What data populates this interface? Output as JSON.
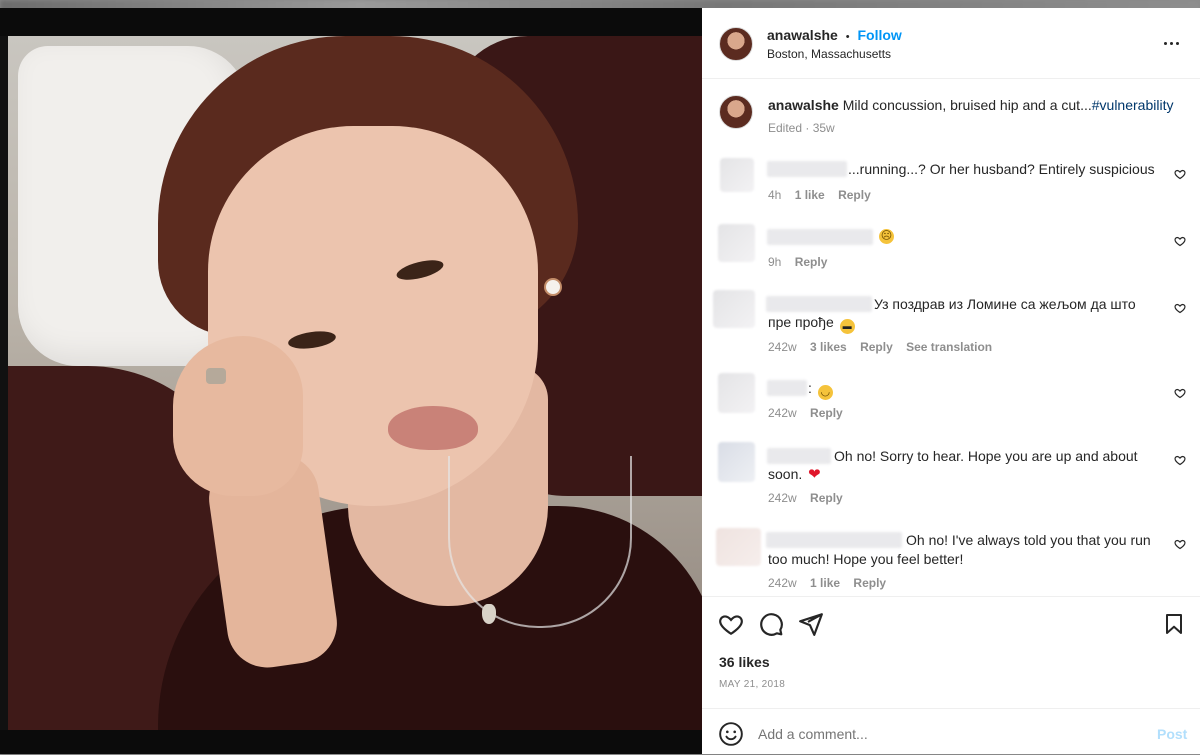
{
  "post": {
    "author": "anawalshe",
    "dot": "•",
    "follow_label": "Follow",
    "location": "Boston, Massachusetts",
    "caption_author": "anawalshe",
    "caption_text": "Mild concussion, bruised hip and a cut...",
    "caption_hashtag": "#vulnerability",
    "caption_meta": "Edited · 35w"
  },
  "comments": [
    {
      "text": "...running...? Or her husband? Entirely suspicious",
      "age": "4h",
      "likes": "1 like",
      "reply": "Reply"
    },
    {
      "text": "",
      "emoji": "disappointed-face-emoji",
      "age": "9h",
      "reply": "Reply"
    },
    {
      "text_line1": "Уз поздрав из Ломине са жељом да што",
      "text_line2": "пре прође",
      "emoji": "sunglasses-face-emoji",
      "age": "242w",
      "likes": "3 likes",
      "reply": "Reply",
      "translate": "See translation"
    },
    {
      "text": ":",
      "emoji": "pensive-face-emoji",
      "age": "242w",
      "reply": "Reply"
    },
    {
      "text_line1": "Oh no! Sorry to hear. Hope you are up and about",
      "text_line2": "soon.",
      "emoji": "red-heart-emoji",
      "age": "242w",
      "reply": "Reply"
    },
    {
      "text_line1": "Oh no! I've always told you that you run",
      "text_line2": "too much! Hope you feel better!",
      "age": "242w",
      "likes": "1 like",
      "reply": "Reply"
    }
  ],
  "stats": {
    "likes": "36 likes",
    "date": "MAY 21, 2018"
  },
  "composer": {
    "placeholder": "Add a comment...",
    "post_label": "Post"
  },
  "colors": {
    "link_blue": "#0095f6",
    "muted_gray": "#8e8e8e",
    "text": "#262626"
  }
}
